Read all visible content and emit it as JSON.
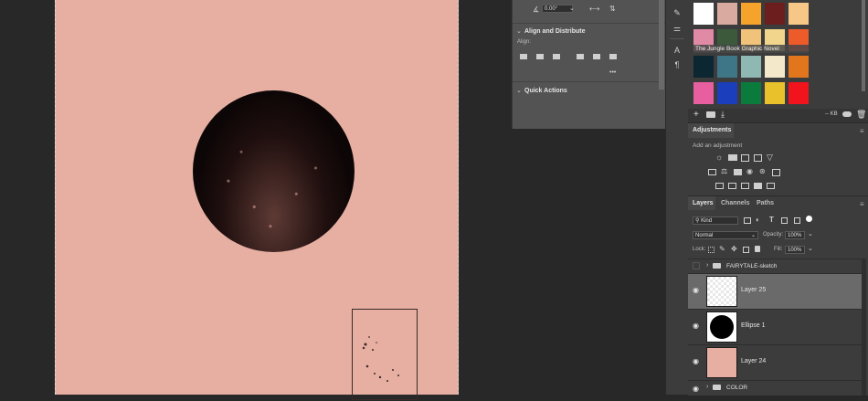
{
  "properties": {
    "rotation": "0.00°",
    "align_distribute_title": "Align and Distribute",
    "align_label": "Align:",
    "more": "•••",
    "quick_actions_title": "Quick Actions"
  },
  "swatches": {
    "group_name": "The Jungle Book Graphic Novel",
    "row1": [
      "#ffffff",
      "#d9aba0",
      "#f6a32b",
      "#6b1e1d",
      "#f7c787"
    ],
    "row2": [
      "#e18aa5",
      "#3c5a3b",
      "#f0c27a",
      "#f2d58c",
      "#ee5b2a"
    ],
    "row3": [
      "#0c2732",
      "#3e7687",
      "#8eb8b1",
      "#f3e8c9",
      "#e2761d"
    ],
    "row4": [
      "#e85fa0",
      "#1b3ebd",
      "#0b7a3d",
      "#e9c12b",
      "#f2141c"
    ],
    "kb_label": "-- KB"
  },
  "adjustments": {
    "title": "Adjustments",
    "add_label": "Add an adjustment"
  },
  "layers_panel": {
    "tabs": [
      "Layers",
      "Channels",
      "Paths"
    ],
    "kind_label": "Kind",
    "blend_mode": "Normal",
    "opacity_label": "Opacity:",
    "opacity_value": "100%",
    "lock_label": "Lock:",
    "fill_label": "Fill:",
    "fill_value": "100%",
    "layers": [
      {
        "name": "FAIRYTALE-sketch",
        "type": "group"
      },
      {
        "name": "Layer 25",
        "type": "layer"
      },
      {
        "name": "Ellipse 1",
        "type": "shape"
      },
      {
        "name": "Layer 24",
        "type": "layer"
      },
      {
        "name": "COLOR",
        "type": "group"
      }
    ]
  },
  "colors": {
    "canvas_bg": "#e7afa2",
    "app_bg": "#282828",
    "panel_bg": "#3c3c3c",
    "selected_layer": "#6a6a6a"
  }
}
